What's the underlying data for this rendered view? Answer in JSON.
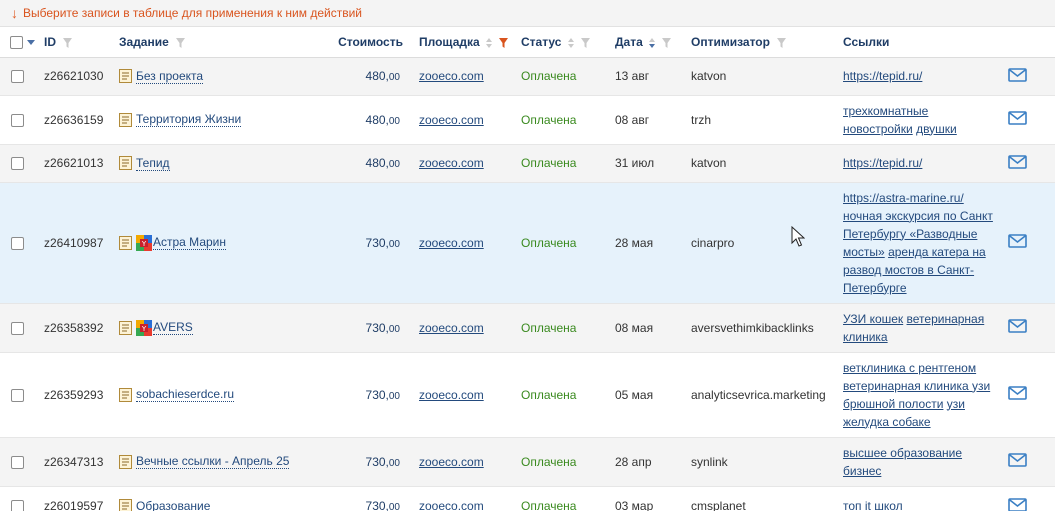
{
  "notice": {
    "text": "Выберите записи в таблице для применения к ним действий"
  },
  "columns": {
    "id": "ID",
    "task": "Задание",
    "price": "Стоимость",
    "site": "Площадка",
    "status": "Статус",
    "date": "Дата",
    "optimizer": "Оптимизатор",
    "links": "Ссылки"
  },
  "rows": [
    {
      "id": "z26621030",
      "task": "Без проекта",
      "price_int": "480,",
      "price_dec": "00",
      "site": "zooeco.com",
      "status": "Оплачена",
      "date": "13 авг",
      "optimizer": "katvon",
      "links": [
        "https://tepid.ru/"
      ]
    },
    {
      "id": "z26636159",
      "task": "Территория Жизни",
      "price_int": "480,",
      "price_dec": "00",
      "site": "zooeco.com",
      "status": "Оплачена",
      "date": "08 авг",
      "optimizer": "trzh",
      "links": [
        "трехкомнатные",
        "новостройки",
        "двушки"
      ]
    },
    {
      "id": "z26621013",
      "task": "Тепид",
      "price_int": "480,",
      "price_dec": "00",
      "site": "zooeco.com",
      "status": "Оплачена",
      "date": "31 июл",
      "optimizer": "katvon",
      "links": [
        "https://tepid.ru/"
      ]
    },
    {
      "id": "z26410987",
      "task": "Астра Марин",
      "price_int": "730,",
      "price_dec": "00",
      "site": "zooeco.com",
      "status": "Оплачена",
      "date": "28 мая",
      "optimizer": "cinarpro",
      "links": [
        "https://astra-marine.ru/",
        "ночная экскурсия по Санкт",
        "Петербургу «Разводные",
        "мосты»",
        "аренда катера на",
        "развод мостов в Санкт-",
        "Петербурге"
      ]
    },
    {
      "id": "z26358392",
      "task": "AVERS",
      "price_int": "730,",
      "price_dec": "00",
      "site": "zooeco.com",
      "status": "Оплачена",
      "date": "08 мая",
      "optimizer": "aversvethimkibacklinks",
      "links": [
        "УЗИ кошек",
        "ветеринарная",
        "клиника"
      ]
    },
    {
      "id": "z26359293",
      "task": "sobachieserdce.ru",
      "price_int": "730,",
      "price_dec": "00",
      "site": "zooeco.com",
      "status": "Оплачена",
      "date": "05 мая",
      "optimizer": "analyticsevrica.marketing",
      "links": [
        "ветклиника с рентгеном",
        "ветеринарная клиника узи",
        "брюшной полости",
        "узи",
        "желудка собаке"
      ]
    },
    {
      "id": "z26347313",
      "task": "Вечные ссылки - Апрель 25",
      "price_int": "730,",
      "price_dec": "00",
      "site": "zooeco.com",
      "status": "Оплачена",
      "date": "28 апр",
      "optimizer": "synlink",
      "links": [
        "высшее образование",
        "бизнес"
      ]
    },
    {
      "id": "z26019597",
      "task": "Образование",
      "price_int": "730,",
      "price_dec": "00",
      "site": "zooeco.com",
      "status": "Оплачена",
      "date": "03 мар",
      "optimizer": "cmsplanet",
      "links": [
        "топ it школ"
      ]
    }
  ],
  "colors": {
    "notice": "#d9541e",
    "header": "#1f3d66",
    "link": "#234a7d",
    "status": "#3a8a1f",
    "filter_active": "#d9541e",
    "hover_row": "#e6f2fb"
  },
  "icons": {
    "document": "document-icon",
    "yandex_badge": "yandex-badge-icon",
    "message": "envelope-icon",
    "filter": "filter-icon",
    "sort": "sort-icon"
  }
}
